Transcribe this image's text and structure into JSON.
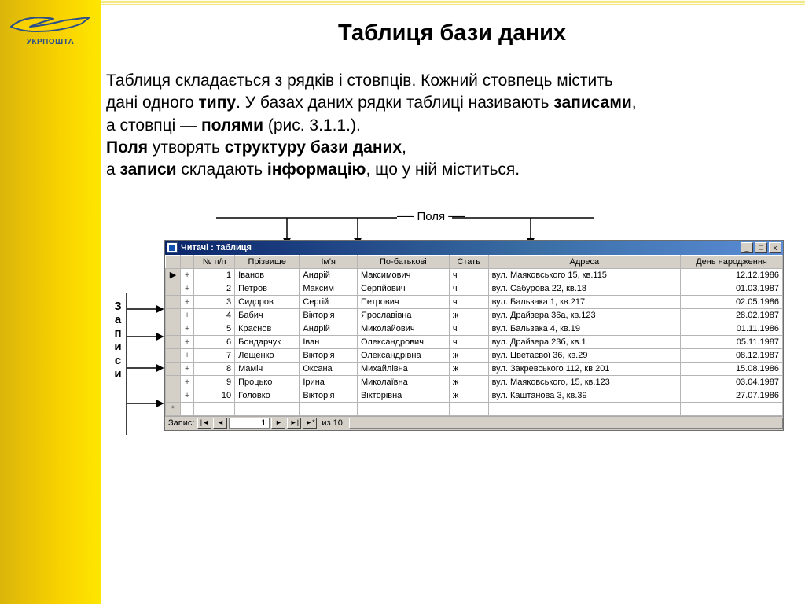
{
  "logo_text": "УКРПОШТА",
  "title": "Таблиця бази даних",
  "paragraph": {
    "l1a": "Таблиця складається з рядків і стовпців. Кожний стовпець містить",
    "l2a": "дані одного ",
    "l2b_bold": "типу",
    "l2c": ". У базах даних рядки таблиці називають ",
    "l2d_bold": "записами",
    "l2e": ",",
    "l3a": "а стовпці — ",
    "l3b_bold": "полями",
    "l3c": " (рис. 3.1.1.).",
    "l4a_bold": "Поля",
    "l4b": " утворять ",
    "l4c_bold": "структуру бази даних",
    "l4d": ",",
    "l5a": "а ",
    "l5b_bold": "записи",
    "l5c": " складають ",
    "l5d_bold": "інформацію",
    "l5e": ", що у ній міститься."
  },
  "labels": {
    "fields": "Поля",
    "records": "Записи"
  },
  "window": {
    "title": "Читачі : таблиця",
    "btn_min": "_",
    "btn_max": "□",
    "btn_close": "x"
  },
  "columns": [
    "№ п/п",
    "Прізвище",
    "Ім'я",
    "По-батькові",
    "Стать",
    "Адреса",
    "День народження"
  ],
  "rows": [
    {
      "n": "1",
      "surname": "Іванов",
      "name": "Андрій",
      "patr": "Максимович",
      "sex": "ч",
      "addr": "вул. Маяковського 15, кв.115",
      "bday": "12.12.1986"
    },
    {
      "n": "2",
      "surname": "Петров",
      "name": "Максим",
      "patr": "Сергійович",
      "sex": "ч",
      "addr": "вул. Сабурова 22, кв.18",
      "bday": "01.03.1987"
    },
    {
      "n": "3",
      "surname": "Сидоров",
      "name": "Сергій",
      "patr": "Петрович",
      "sex": "ч",
      "addr": "вул. Бальзака 1, кв.217",
      "bday": "02.05.1986"
    },
    {
      "n": "4",
      "surname": "Бабич",
      "name": "Вікторія",
      "patr": "Ярославівна",
      "sex": "ж",
      "addr": "вул. Драйзера 36а, кв.123",
      "bday": "28.02.1987"
    },
    {
      "n": "5",
      "surname": "Краснов",
      "name": "Андрій",
      "patr": "Миколайович",
      "sex": "ч",
      "addr": "вул. Бальзака 4, кв.19",
      "bday": "01.11.1986"
    },
    {
      "n": "6",
      "surname": "Бондарчук",
      "name": "Іван",
      "patr": "Олександрович",
      "sex": "ч",
      "addr": "вул. Драйзера 23б, кв.1",
      "bday": "05.11.1987"
    },
    {
      "n": "7",
      "surname": "Лещенко",
      "name": "Вікторія",
      "patr": "Олександрівна",
      "sex": "ж",
      "addr": "вул. Цветаєвої 36, кв.29",
      "bday": "08.12.1987"
    },
    {
      "n": "8",
      "surname": "Маміч",
      "name": "Оксана",
      "patr": "Михайлівна",
      "sex": "ж",
      "addr": "вул. Закревського 112, кв.201",
      "bday": "15.08.1986"
    },
    {
      "n": "9",
      "surname": "Процько",
      "name": "Ірина",
      "patr": "Миколаївна",
      "sex": "ж",
      "addr": "вул. Маяковського, 15, кв.123",
      "bday": "03.04.1987"
    },
    {
      "n": "10",
      "surname": "Головко",
      "name": "Вікторія",
      "patr": "Вікторівна",
      "sex": "ж",
      "addr": "вул. Каштанова 3, кв.39",
      "bday": "27.07.1986"
    }
  ],
  "nav": {
    "label": "Запис:",
    "first": "|◄",
    "prev": "◄",
    "value": "1",
    "next": "►",
    "last": "►|",
    "new": "►*",
    "of": "из  10"
  },
  "selector_marker": "▶",
  "expand_marker": "+"
}
